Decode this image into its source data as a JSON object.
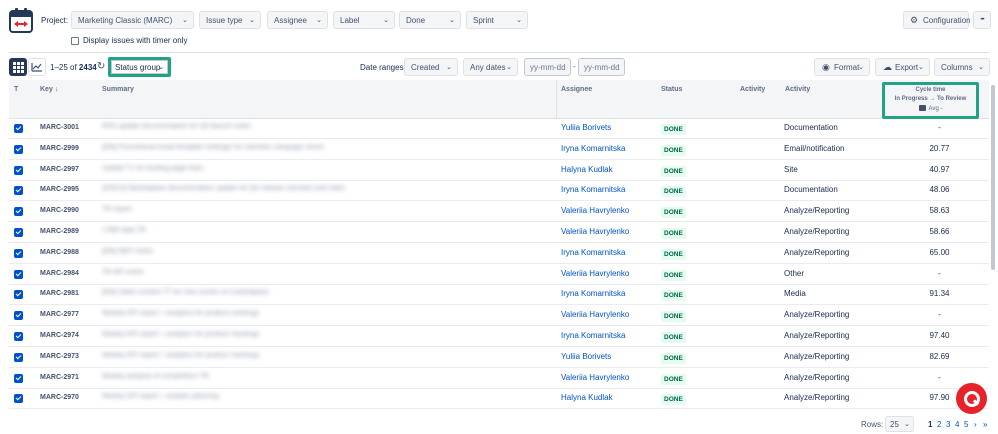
{
  "filters": {
    "project_label": "Project:",
    "project_value": "Marketing Classic (MARC)",
    "issue_type": "Issue type",
    "assignee": "Assignee",
    "label": "Label",
    "done": "Done",
    "sprint": "Sprint",
    "timer_label": "Display issues with timer only",
    "configuration": "Configuration",
    "more": "•••"
  },
  "toolbar": {
    "range_prefix": "1–25 of ",
    "range_total": "2434",
    "status_group": "Status group",
    "date_ranges_label": "Date ranges:",
    "created": "Created",
    "any_dates": "Any dates",
    "date_from_placeholder": "yy-mm-dd",
    "date_to_placeholder": "yy-mm-dd",
    "date_dash": "-",
    "format": "Format",
    "export": "Export",
    "columns": "Columns"
  },
  "table": {
    "headers": {
      "t": "T",
      "key": "Key ↓",
      "summary": "Summary",
      "assignee": "Assignee",
      "status": "Status",
      "activity1": "Activity",
      "activity2": "Activity"
    },
    "cycle": {
      "title": "Cycle time",
      "sub": "In Progress → To Review",
      "avg": "Avg -"
    },
    "rows": [
      {
        "key": "MARC-3001",
        "summary": "RSS update documentation for Q3 launch notes",
        "assignee": "Yuliia Borivets",
        "status": "DONE",
        "activity": "Documentation",
        "cycle": "-"
      },
      {
        "key": "MARC-2999",
        "summary": "[EM] Promotional email template redesign for retention campaign series",
        "assignee": "Iryna Komarnitska",
        "status": "DONE",
        "activity": "Email/notification",
        "cycle": "20.77"
      },
      {
        "key": "MARC-2997",
        "summary": "Update T1 for landing page fixes",
        "assignee": "Halyna Kudlak",
        "status": "DONE",
        "activity": "Site",
        "cycle": "40.97"
      },
      {
        "key": "MARC-2995",
        "summary": "[DOCS] Marketplace documentation update for Q4 release checklist and notes",
        "assignee": "Iryna Komarnitska",
        "status": "DONE",
        "activity": "Documentation",
        "cycle": "48.06"
      },
      {
        "key": "MARC-2990",
        "summary": "TR report",
        "assignee": "Valeriia Havrylenko",
        "status": "DONE",
        "activity": "Analyze/Reporting",
        "cycle": "58.63"
      },
      {
        "key": "MARC-2989",
        "summary": "LTBR data TR",
        "assignee": "Valeriia Havrylenko",
        "status": "DONE",
        "activity": "Analyze/Reporting",
        "cycle": "58.66"
      },
      {
        "key": "MARC-2988",
        "summary": "[EM] NKP metric",
        "assignee": "Iryna Komarnitska",
        "status": "DONE",
        "activity": "Analyze/Reporting",
        "cycle": "65.00"
      },
      {
        "key": "MARC-2984",
        "summary": "TR API event",
        "assignee": "Valeriia Havrylenko",
        "status": "DONE",
        "activity": "Other",
        "cycle": "-"
      },
      {
        "key": "MARC-2981",
        "summary": "[EM] Video content TT for new screen on marketplace",
        "assignee": "Iryna Komarnitska",
        "status": "DONE",
        "activity": "Media",
        "cycle": "91.34"
      },
      {
        "key": "MARC-2977",
        "summary": "Weekly KPI report + analytics for product meetings",
        "assignee": "Valeriia Havrylenko",
        "status": "DONE",
        "activity": "Analyze/Reporting",
        "cycle": "-"
      },
      {
        "key": "MARC-2974",
        "summary": "Weekly KPI report + analytics for product meetings",
        "assignee": "Iryna Komarnitska",
        "status": "DONE",
        "activity": "Analyze/Reporting",
        "cycle": "97.40"
      },
      {
        "key": "MARC-2973",
        "summary": "Weekly KPI report + analytics for product meetings",
        "assignee": "Yuliia Borivets",
        "status": "DONE",
        "activity": "Analyze/Reporting",
        "cycle": "82.69"
      },
      {
        "key": "MARC-2971",
        "summary": "Weekly analysis of competitors TR",
        "assignee": "Valeriia Havrylenko",
        "status": "DONE",
        "activity": "Analyze/Reporting",
        "cycle": "-"
      },
      {
        "key": "MARC-2970",
        "summary": "Weekly KPI report + analytic planning",
        "assignee": "Halyna Kudlak",
        "status": "DONE",
        "activity": "Analyze/Reporting",
        "cycle": "97.90"
      }
    ]
  },
  "pagination": {
    "rows_label": "Rows:",
    "rows_value": "25",
    "pages": [
      "1",
      "2",
      "3",
      "4",
      "5"
    ],
    "next": "›",
    "last": "»"
  }
}
